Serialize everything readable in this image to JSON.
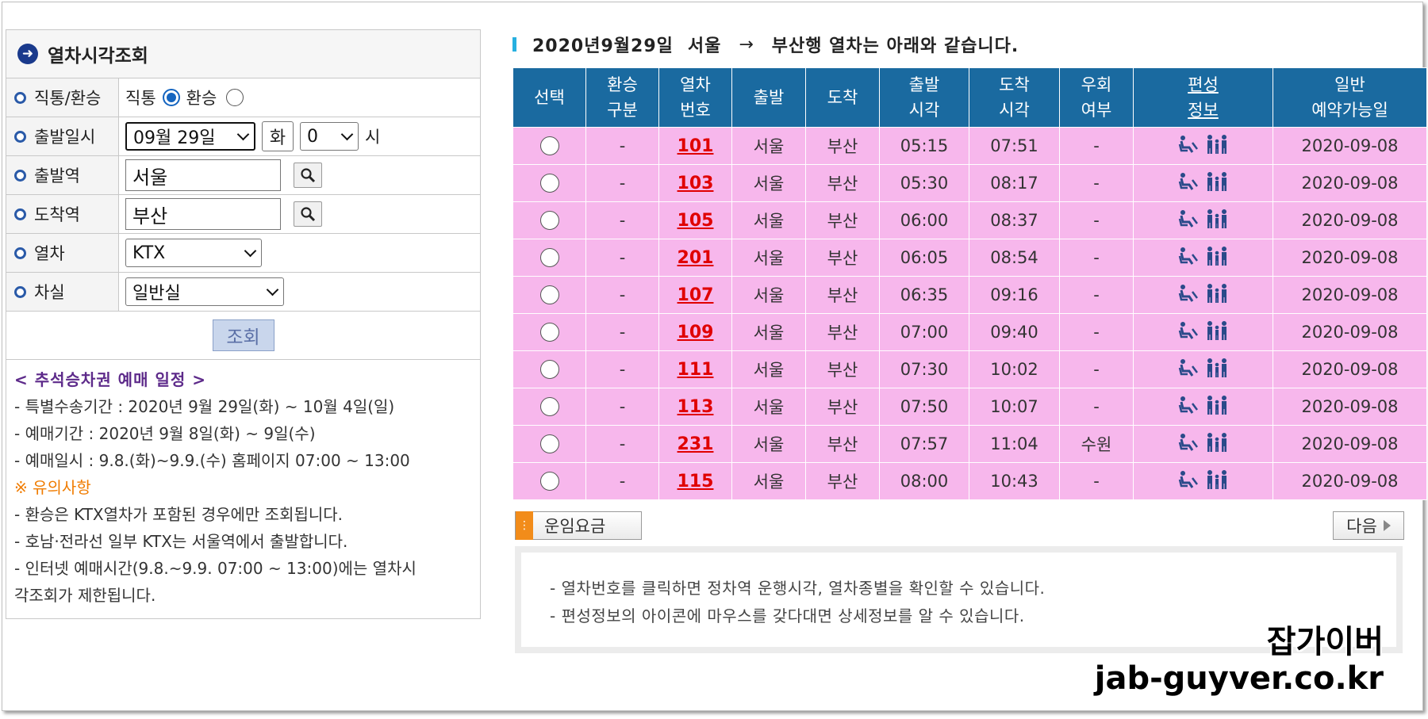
{
  "left_panel": {
    "title": "열차시각조회",
    "rows": {
      "type": {
        "label": "직통/환승",
        "opt_direct": "직통",
        "opt_transfer": "환승",
        "selected": "직통"
      },
      "date": {
        "label": "출발일시",
        "date_value": "09월 29일",
        "day": "화",
        "hour_value": "0",
        "hour_unit": "시"
      },
      "departure": {
        "label": "출발역",
        "value": "서울"
      },
      "arrival": {
        "label": "도착역",
        "value": "부산"
      },
      "train": {
        "label": "열차",
        "value": "KTX"
      },
      "seat": {
        "label": "차실",
        "value": "일반실"
      }
    },
    "query_button": "조회",
    "notice": {
      "title": "< 추석승차권 예매 일정 >",
      "line1": "- 특별수송기간 : 2020년 9월 29일(화) ~ 10월 4일(일)",
      "line2": "- 예매기간 : 2020년 9월 8일(화) ~ 9일(수)",
      "line3": "- 예매일시 : 9.8.(화)~9.9.(수) 홈페이지 07:00 ~ 13:00",
      "warn_title": "※ 유의사항",
      "line4": "- 환승은 KTX열차가 포함된 경우에만 조회됩니다.",
      "line5": "- 호남·전라선 일부 KTX는 서울역에서 출발합니다.",
      "line6": "- 인터넷 예매시간(9.8.~9.9. 07:00 ~ 13:00)에는 열차시",
      "line7": "각조회가 제한됩니다."
    }
  },
  "result": {
    "title_date": "2020년9월29일",
    "title_from": "서울",
    "title_arrow": "→",
    "title_rest": "부산행 열차는 아래와 같습니다.",
    "headers": {
      "select": "선택",
      "transfer_1": "환승",
      "transfer_2": "구분",
      "train_1": "열차",
      "train_2": "번호",
      "dep": "출발",
      "arr": "도착",
      "dep_time_1": "출발",
      "dep_time_2": "시각",
      "arr_time_1": "도착",
      "arr_time_2": "시각",
      "detour_1": "우회",
      "detour_2": "여부",
      "formation_1": "편성",
      "formation_2": "정보",
      "booking_1": "일반",
      "booking_2": "예약가능일"
    },
    "rows": [
      {
        "transfer": "-",
        "no": "101",
        "dep": "서울",
        "arr": "부산",
        "dep_time": "05:15",
        "arr_time": "07:51",
        "detour": "-",
        "booking": "2020-09-08"
      },
      {
        "transfer": "-",
        "no": "103",
        "dep": "서울",
        "arr": "부산",
        "dep_time": "05:30",
        "arr_time": "08:17",
        "detour": "-",
        "booking": "2020-09-08"
      },
      {
        "transfer": "-",
        "no": "105",
        "dep": "서울",
        "arr": "부산",
        "dep_time": "06:00",
        "arr_time": "08:37",
        "detour": "-",
        "booking": "2020-09-08"
      },
      {
        "transfer": "-",
        "no": "201",
        "dep": "서울",
        "arr": "부산",
        "dep_time": "06:05",
        "arr_time": "08:54",
        "detour": "-",
        "booking": "2020-09-08"
      },
      {
        "transfer": "-",
        "no": "107",
        "dep": "서울",
        "arr": "부산",
        "dep_time": "06:35",
        "arr_time": "09:16",
        "detour": "-",
        "booking": "2020-09-08"
      },
      {
        "transfer": "-",
        "no": "109",
        "dep": "서울",
        "arr": "부산",
        "dep_time": "07:00",
        "arr_time": "09:40",
        "detour": "-",
        "booking": "2020-09-08"
      },
      {
        "transfer": "-",
        "no": "111",
        "dep": "서울",
        "arr": "부산",
        "dep_time": "07:30",
        "arr_time": "10:02",
        "detour": "-",
        "booking": "2020-09-08"
      },
      {
        "transfer": "-",
        "no": "113",
        "dep": "서울",
        "arr": "부산",
        "dep_time": "07:50",
        "arr_time": "10:07",
        "detour": "-",
        "booking": "2020-09-08"
      },
      {
        "transfer": "-",
        "no": "231",
        "dep": "서울",
        "arr": "부산",
        "dep_time": "07:57",
        "arr_time": "11:04",
        "detour": "수원",
        "booking": "2020-09-08"
      },
      {
        "transfer": "-",
        "no": "115",
        "dep": "서울",
        "arr": "부산",
        "dep_time": "08:00",
        "arr_time": "10:43",
        "detour": "-",
        "booking": "2020-09-08"
      }
    ],
    "fare_button": "운임요금",
    "next_button": "다음",
    "info_line1": "- 열차번호를 클릭하면 정차역 운행시각, 열차종별을 확인할 수 있습니다.",
    "info_line2": "- 편성정보의 아이콘에 마우스를 갖다대면 상세정보를 알 수 있습니다."
  },
  "watermark": {
    "line1": "잡가이버",
    "line2": "jab-guyver.co.kr"
  },
  "colors": {
    "header_bg": "#1a6aa0",
    "row_bg": "#f7b7ec",
    "train_no": "#e00000",
    "notice_title": "#5d2a8a",
    "warn": "#f07c00"
  }
}
